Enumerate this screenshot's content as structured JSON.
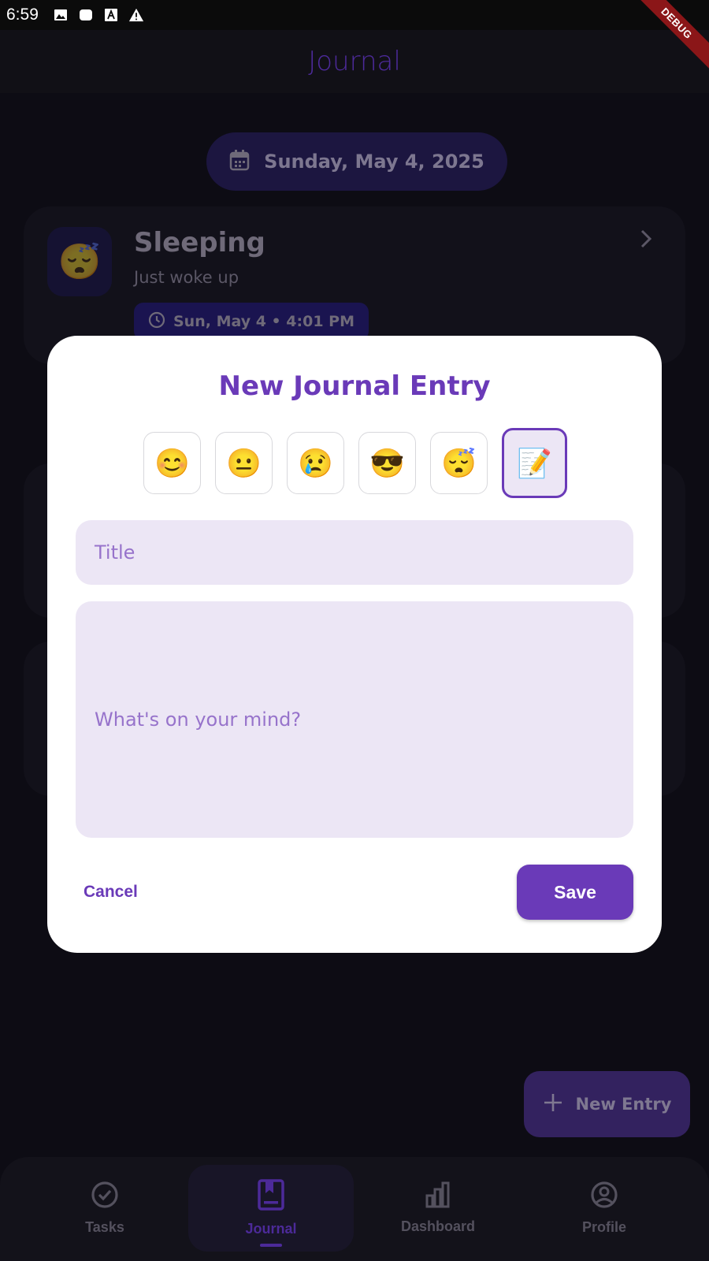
{
  "status_bar": {
    "time": "6:59",
    "debug_label": "DEBUG"
  },
  "app_bar": {
    "title": "Journal"
  },
  "date_pill": {
    "label": "Sunday, May 4, 2025"
  },
  "entry_card": {
    "emoji": "😴",
    "title": "Sleeping",
    "subtitle": "Just woke up",
    "time": "Sun, May 4 • 4:01 PM"
  },
  "dialog": {
    "title": "New Journal Entry",
    "moods": [
      "😊",
      "😐",
      "😢",
      "😎",
      "😴",
      "📝"
    ],
    "selected_mood_index": 5,
    "title_placeholder": "Title",
    "body_placeholder": "What's on your mind?",
    "cancel_label": "Cancel",
    "save_label": "Save"
  },
  "fab": {
    "label": "New Entry"
  },
  "bottom_nav": {
    "items": [
      {
        "label": "Tasks",
        "icon": "check-circle-icon"
      },
      {
        "label": "Journal",
        "icon": "journal-book-icon"
      },
      {
        "label": "Dashboard",
        "icon": "bar-chart-icon"
      },
      {
        "label": "Profile",
        "icon": "account-circle-icon"
      }
    ],
    "active_index": 1
  },
  "colors": {
    "accent": "#6a3ab8",
    "field_bg": "#ece6f5",
    "placeholder": "#9773cb",
    "background": "#0d0c14"
  }
}
